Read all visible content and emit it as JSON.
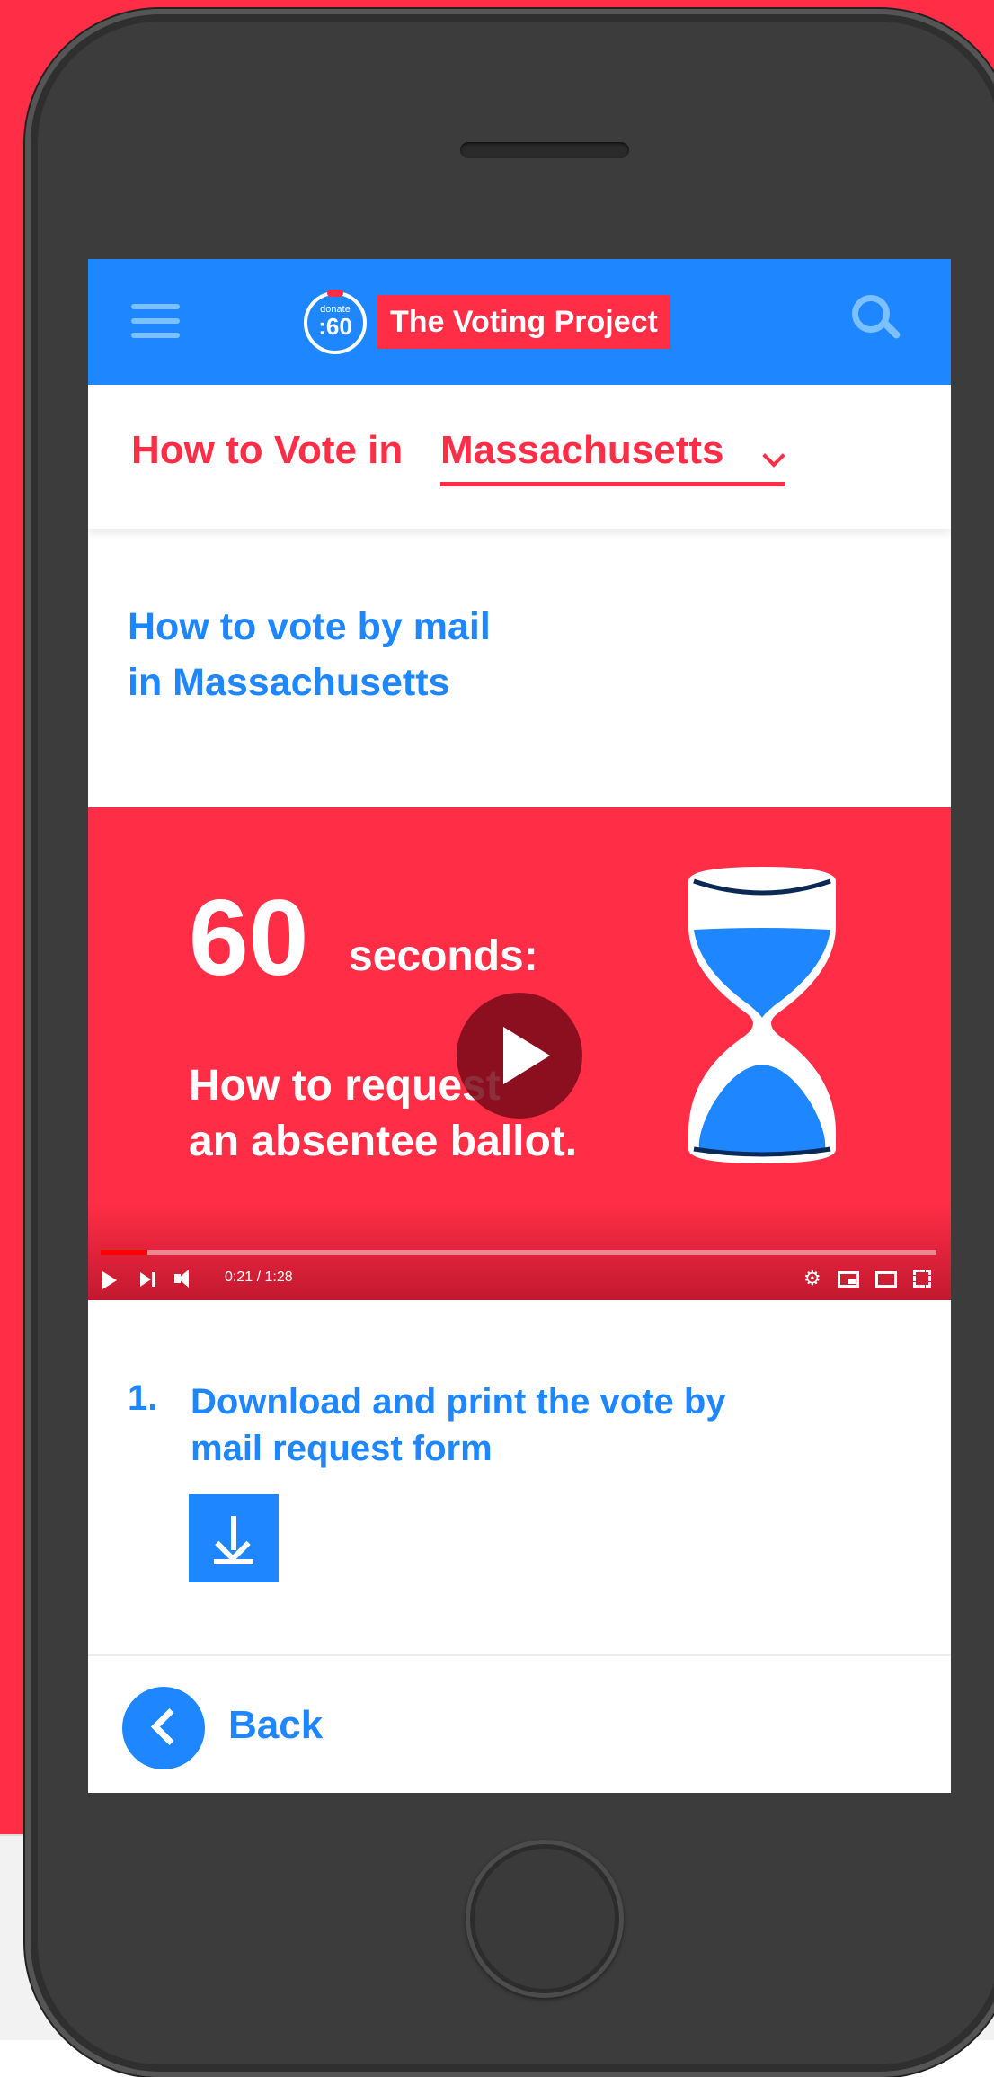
{
  "header": {
    "logo_small": "donate",
    "logo_big": ":60",
    "brand": "The Voting Project"
  },
  "state_selector": {
    "prefix": "How to Vote in",
    "state": "Massachusetts"
  },
  "page": {
    "title_line1": "How to vote by mail",
    "title_line2": "in Massachusetts"
  },
  "video": {
    "number": "60",
    "seconds_label": "seconds:",
    "line1": "How to request",
    "line2": "an absentee ballot.",
    "time": "0:21 / 1:28",
    "progress_fraction": 0.056
  },
  "steps": [
    {
      "number": "1.",
      "line1": "Download and print the vote by",
      "line2": "mail request form"
    }
  ],
  "footer": {
    "back_label": "Back"
  },
  "colors": {
    "brand_red": "#ff2d46",
    "brand_blue": "#1e86ff"
  }
}
